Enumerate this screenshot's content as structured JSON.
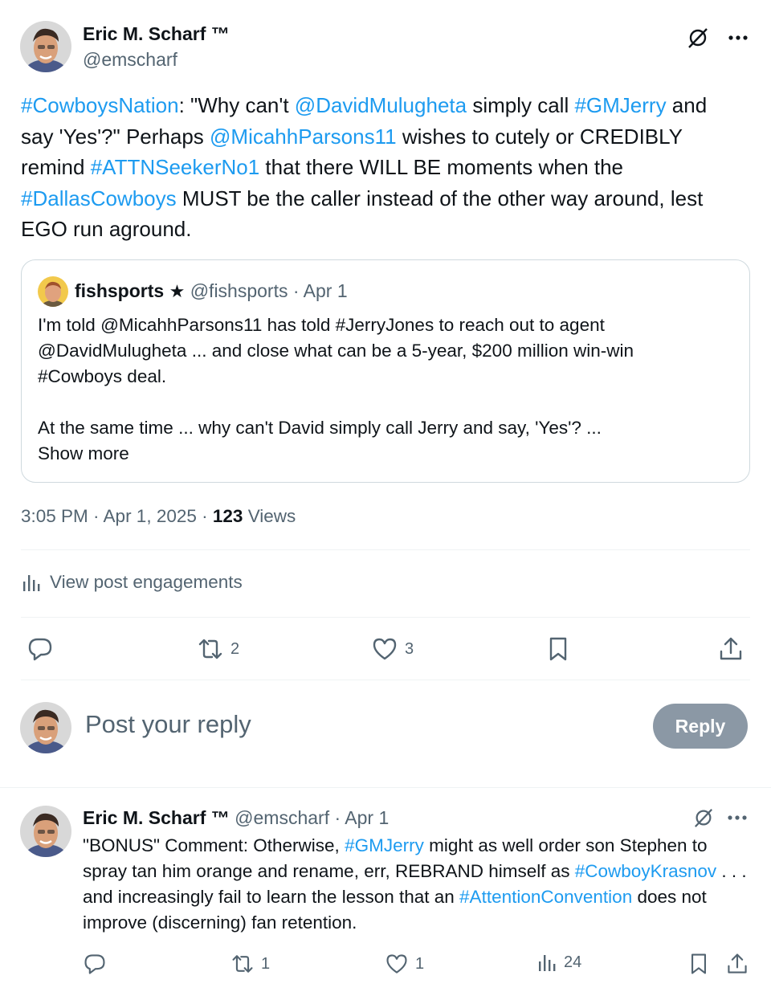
{
  "post": {
    "author_name": "Eric M. Scharf ™",
    "author_handle": "@emscharf",
    "text_parts": [
      {
        "t": "#CowboysNation",
        "link": true
      },
      {
        "t": ": \"Why can't ",
        "link": false
      },
      {
        "t": "@DavidMulugheta",
        "link": true
      },
      {
        "t": " simply call ",
        "link": false
      },
      {
        "t": "#GMJerry",
        "link": true
      },
      {
        "t": " and say 'Yes'?\" Perhaps ",
        "link": false
      },
      {
        "t": "@MicahhParsons11",
        "link": true
      },
      {
        "t": " wishes to cutely or CREDIBLY remind ",
        "link": false
      },
      {
        "t": "#ATTNSeekerNo1",
        "link": true
      },
      {
        "t": " that there WILL BE moments when the ",
        "link": false
      },
      {
        "t": "#DallasCowboys",
        "link": true
      },
      {
        "t": " MUST be the caller instead of the other way around, lest EGO run aground.",
        "link": false
      }
    ],
    "quote": {
      "author_name": "fishsports",
      "badge": "★",
      "author_handle": "@fishsports",
      "date": "· Apr 1",
      "paragraph1": "I'm told @MicahhParsons11 has told #JerryJones to reach out to agent @DavidMulugheta ... and close what can be a 5-year, $200 million win-win #Cowboys deal.",
      "paragraph2": "At the same time ... why can't David simply call Jerry and say, 'Yes'? ...",
      "show_more": "Show more"
    },
    "timestamp": "3:05 PM · Apr 1, 2025 · ",
    "views_count": "123",
    "views_label": " Views",
    "engagements_label": "View post engagements",
    "actions": {
      "reply_count": "",
      "repost_count": "2",
      "like_count": "3"
    }
  },
  "composer": {
    "placeholder": "Post your reply",
    "button_label": "Reply"
  },
  "reply": {
    "author_name": "Eric M. Scharf ™",
    "author_handle": "@emscharf",
    "date": "· Apr 1",
    "text_parts": [
      {
        "t": "\"BONUS\" Comment: Otherwise, ",
        "link": false
      },
      {
        "t": "#GMJerry",
        "link": true
      },
      {
        "t": " might as well order son Stephen to spray tan him orange and rename, err, REBRAND himself as ",
        "link": false
      },
      {
        "t": "#CowboyKrasnov",
        "link": true
      },
      {
        "t": " . . . and increasingly fail to learn the lesson that an ",
        "link": false
      },
      {
        "t": "#AttentionConvention",
        "link": true
      },
      {
        "t": " does not improve (discerning) fan retention.",
        "link": false
      }
    ],
    "actions": {
      "repost_count": "1",
      "like_count": "1",
      "views_count": "24"
    }
  },
  "colors": {
    "link": "#1d9bf0",
    "text": "#0f1419",
    "muted": "#536471",
    "reply_button": "#8b98a5"
  },
  "icons": [
    "grok-icon",
    "more-icon",
    "reply-icon",
    "repost-icon",
    "like-icon",
    "bookmark-icon",
    "share-icon",
    "analytics-icon"
  ]
}
